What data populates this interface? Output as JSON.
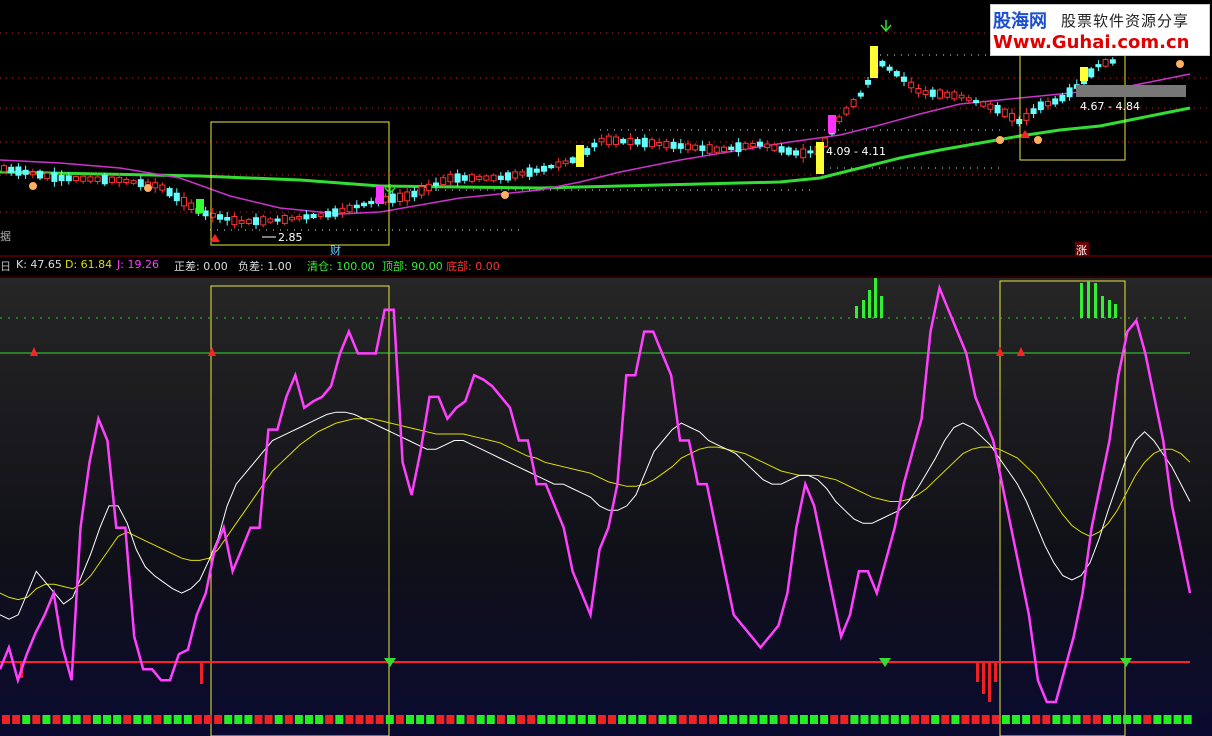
{
  "watermark": {
    "site_name": "股海网",
    "slogan": "股票软件资源分享",
    "url": "Www.Guhai.com.cn"
  },
  "price_panel": {
    "left_cut_label": "据",
    "price_labels": [
      "4.09 - 4.11",
      "4.67 - 4.84",
      "2.85"
    ],
    "markers": {
      "cai": "财",
      "zhang": "涨"
    }
  },
  "indicator_header": {
    "left_cut": "日",
    "k": "K: 47.65",
    "d": "D: 61.84",
    "j": "J: 19.26",
    "zhengcha": "正差: 0.00",
    "fucha": "负差: 1.00",
    "qingcang": "清仓: 100.00",
    "dingbu": "顶部: 90.00",
    "dibu": "底部: 0.00"
  },
  "colors": {
    "k_line": "#ffffff",
    "d_line": "#e0e000",
    "j_line": "#ff40ff",
    "ma_long": "#33dd33",
    "ma_short": "#cc33cc",
    "up_candle": "#ff3333",
    "down_candle": "#66ffff",
    "box": "#e8e840"
  },
  "chart_data": {
    "type": "line",
    "series": [
      {
        "name": "J",
        "values": [
          -5,
          5,
          -10,
          2,
          12,
          20,
          30,
          5,
          -10,
          60,
          90,
          110,
          100,
          60,
          60,
          10,
          -5,
          -5,
          -10,
          -10,
          2,
          4,
          20,
          30,
          50,
          60,
          40,
          50,
          60,
          60,
          105,
          105,
          120,
          130,
          115,
          118,
          120,
          125,
          140,
          150,
          140,
          140,
          140,
          160,
          160,
          90,
          75,
          95,
          120,
          120,
          110,
          115,
          118,
          130,
          128,
          125,
          120,
          115,
          100,
          100,
          80,
          80,
          70,
          60,
          40,
          30,
          20,
          50,
          60,
          80,
          130,
          130,
          150,
          150,
          140,
          130,
          100,
          100,
          80,
          80,
          60,
          40,
          20,
          15,
          10,
          5,
          10,
          15,
          30,
          60,
          80,
          70,
          50,
          30,
          10,
          20,
          40,
          40,
          30,
          45,
          60,
          80,
          95,
          110,
          150,
          170,
          160,
          150,
          140,
          120,
          110,
          100,
          80,
          60,
          40,
          20,
          -10,
          -20,
          -20,
          -5,
          10,
          30,
          60,
          80,
          100,
          130,
          150,
          155,
          140,
          120,
          100,
          70,
          50,
          30
        ]
      },
      {
        "name": "K",
        "values": [
          20,
          18,
          20,
          30,
          40,
          35,
          30,
          25,
          28,
          38,
          48,
          60,
          70,
          70,
          62,
          50,
          42,
          38,
          35,
          32,
          30,
          32,
          36,
          45,
          55,
          70,
          80,
          85,
          90,
          95,
          100,
          102,
          104,
          106,
          108,
          110,
          112,
          113,
          113,
          112,
          110,
          108,
          106,
          104,
          102,
          100,
          98,
          96,
          96,
          98,
          100,
          100,
          98,
          96,
          94,
          92,
          90,
          88,
          86,
          84,
          82,
          80,
          80,
          78,
          76,
          74,
          70,
          68,
          68,
          70,
          75,
          85,
          95,
          100,
          105,
          108,
          106,
          104,
          100,
          98,
          96,
          94,
          90,
          86,
          82,
          80,
          80,
          82,
          84,
          84,
          82,
          78,
          72,
          68,
          64,
          62,
          62,
          64,
          66,
          68,
          72,
          78,
          85,
          92,
          100,
          106,
          108,
          106,
          102,
          98,
          92,
          86,
          80,
          72,
          62,
          52,
          44,
          38,
          36,
          38,
          44,
          55,
          68,
          80,
          92,
          100,
          104,
          100,
          94,
          88,
          80,
          72
        ]
      },
      {
        "name": "D",
        "values": [
          30,
          28,
          27,
          28,
          32,
          34,
          34,
          33,
          32,
          34,
          38,
          44,
          50,
          56,
          58,
          56,
          54,
          52,
          50,
          48,
          46,
          45,
          45,
          46,
          50,
          56,
          62,
          68,
          74,
          80,
          86,
          90,
          94,
          98,
          101,
          104,
          106,
          108,
          109,
          110,
          110,
          110,
          109,
          108,
          107,
          106,
          105,
          104,
          103,
          103,
          103,
          103,
          102,
          101,
          100,
          99,
          97,
          95,
          93,
          92,
          90,
          89,
          88,
          87,
          86,
          85,
          83,
          81,
          80,
          79,
          79,
          80,
          82,
          85,
          88,
          92,
          94,
          96,
          97,
          97,
          96,
          95,
          94,
          92,
          90,
          88,
          86,
          85,
          84,
          84,
          84,
          83,
          82,
          80,
          78,
          76,
          74,
          73,
          72,
          72,
          73,
          75,
          78,
          82,
          86,
          90,
          94,
          96,
          97,
          97,
          96,
          94,
          92,
          88,
          84,
          78,
          72,
          66,
          61,
          58,
          56,
          58,
          62,
          68,
          76,
          84,
          90,
          94,
          96,
          96,
          94,
          90
        ]
      }
    ],
    "ylim": [
      -20,
      170
    ]
  }
}
